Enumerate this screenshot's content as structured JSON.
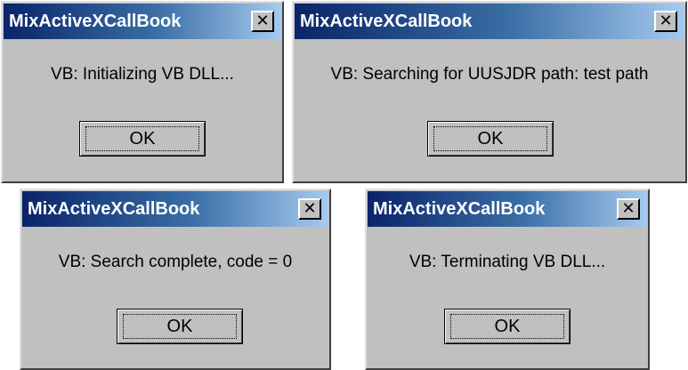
{
  "dialogs": [
    {
      "title": "MixActiveXCallBook",
      "message": "VB: Initializing VB DLL...",
      "ok_label": "OK",
      "close_glyph": "✕"
    },
    {
      "title": "MixActiveXCallBook",
      "message": "VB: Searching for UUSJDR path: test path",
      "ok_label": "OK",
      "close_glyph": "✕"
    },
    {
      "title": "MixActiveXCallBook",
      "message": "VB: Search complete, code =  0",
      "ok_label": "OK",
      "close_glyph": "✕"
    },
    {
      "title": "MixActiveXCallBook",
      "message": "VB: Terminating VB DLL...",
      "ok_label": "OK",
      "close_glyph": "✕"
    }
  ],
  "colors": {
    "titlebar_start": "#0a246a",
    "titlebar_end": "#a6caf0",
    "dialog_face": "#c0c0c0"
  },
  "icons": {
    "close": "close-icon"
  }
}
